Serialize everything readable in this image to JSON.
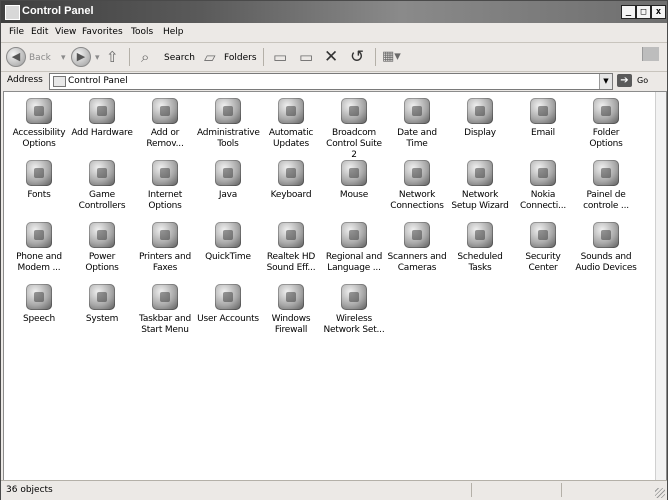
{
  "window": {
    "title": "Control Panel"
  },
  "menu": [
    "File",
    "Edit",
    "View",
    "Favorites",
    "Tools",
    "Help"
  ],
  "toolbar": {
    "back": "Back",
    "search": "Search",
    "folders": "Folders",
    "icons": [
      "back-icon",
      "forward-icon",
      "up-folder-icon",
      "search-icon",
      "folders-icon",
      "move-to-icon",
      "copy-to-icon",
      "delete-icon",
      "undo-icon",
      "views-icon"
    ]
  },
  "address": {
    "label": "Address",
    "value": "Control Panel",
    "go": "Go"
  },
  "items": [
    {
      "label": "Accessibility Options",
      "icon": "accessibility-icon"
    },
    {
      "label": "Add Hardware",
      "icon": "add-hardware-icon"
    },
    {
      "label": "Add or Remov...",
      "icon": "add-remove-programs-icon"
    },
    {
      "label": "Administrative Tools",
      "icon": "administrative-tools-icon"
    },
    {
      "label": "Automatic Updates",
      "icon": "automatic-updates-icon"
    },
    {
      "label": "Broadcom Control Suite 2",
      "icon": "broadcom-icon"
    },
    {
      "label": "Date and Time",
      "icon": "date-time-icon"
    },
    {
      "label": "Display",
      "icon": "display-icon"
    },
    {
      "label": "Email",
      "icon": "email-icon"
    },
    {
      "label": "Folder Options",
      "icon": "folder-options-icon"
    },
    {
      "label": "Fonts",
      "icon": "fonts-icon"
    },
    {
      "label": "Game Controllers",
      "icon": "game-controllers-icon"
    },
    {
      "label": "Internet Options",
      "icon": "internet-options-icon"
    },
    {
      "label": "Java",
      "icon": "java-icon"
    },
    {
      "label": "Keyboard",
      "icon": "keyboard-icon"
    },
    {
      "label": "Mouse",
      "icon": "mouse-icon"
    },
    {
      "label": "Network Connections",
      "icon": "network-connections-icon"
    },
    {
      "label": "Network Setup Wizard",
      "icon": "network-setup-icon"
    },
    {
      "label": "Nokia Connecti...",
      "icon": "nokia-icon"
    },
    {
      "label": "Painel de controle ...",
      "icon": "painel-icon"
    },
    {
      "label": "Phone and Modem ...",
      "icon": "phone-modem-icon"
    },
    {
      "label": "Power Options",
      "icon": "power-options-icon"
    },
    {
      "label": "Printers and Faxes",
      "icon": "printers-faxes-icon"
    },
    {
      "label": "QuickTime",
      "icon": "quicktime-icon"
    },
    {
      "label": "Realtek HD Sound Eff...",
      "icon": "realtek-sound-icon"
    },
    {
      "label": "Regional and Language ...",
      "icon": "regional-language-icon"
    },
    {
      "label": "Scanners and Cameras",
      "icon": "scanners-cameras-icon"
    },
    {
      "label": "Scheduled Tasks",
      "icon": "scheduled-tasks-icon"
    },
    {
      "label": "Security Center",
      "icon": "security-center-icon"
    },
    {
      "label": "Sounds and Audio Devices",
      "icon": "sounds-audio-icon"
    },
    {
      "label": "Speech",
      "icon": "speech-icon"
    },
    {
      "label": "System",
      "icon": "system-icon"
    },
    {
      "label": "Taskbar and Start Menu",
      "icon": "taskbar-start-icon"
    },
    {
      "label": "User Accounts",
      "icon": "user-accounts-icon"
    },
    {
      "label": "Windows Firewall",
      "icon": "windows-firewall-icon"
    },
    {
      "label": "Wireless Network Set...",
      "icon": "wireless-network-icon"
    }
  ],
  "status": {
    "text": "36 objects"
  }
}
